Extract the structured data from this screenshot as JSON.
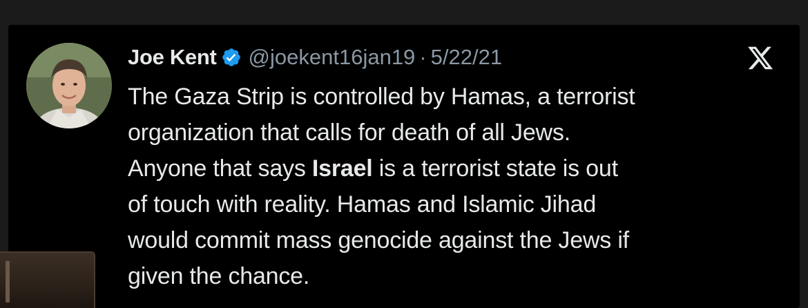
{
  "tweet": {
    "author_name": "Joe Kent",
    "handle": "@joekent16jan19",
    "separator": "·",
    "date": "5/22/21",
    "verified_icon": "verified-badge-icon",
    "platform_icon": "x-logo-icon",
    "accent_color": "#1d9bf0",
    "lines": [
      {
        "pre": "The Gaza Strip is controlled by Hamas, a terrorist",
        "bold": "",
        "post": ""
      },
      {
        "pre": "organization that calls for death of all Jews.",
        "bold": "",
        "post": ""
      },
      {
        "pre": "Anyone that says ",
        "bold": "Israel",
        "post": " is a terrorist state is out"
      },
      {
        "pre": "of touch with reality. Hamas and Islamic Jihad",
        "bold": "",
        "post": ""
      },
      {
        "pre": "would commit mass genocide against the Jews if",
        "bold": "",
        "post": ""
      },
      {
        "pre": "given the chance.",
        "bold": "",
        "post": ""
      }
    ]
  }
}
